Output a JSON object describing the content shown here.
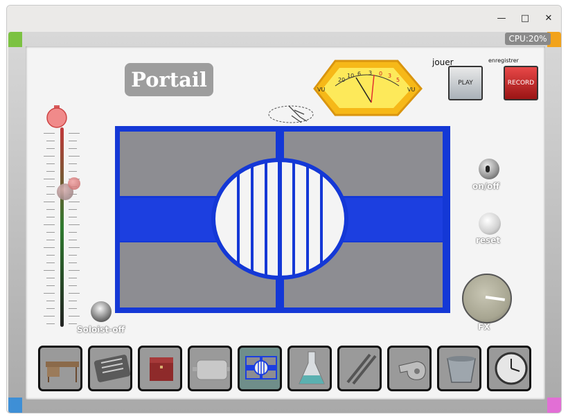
{
  "window": {
    "minimize_glyph": "—",
    "maximize_glyph": "□",
    "close_glyph": "✕"
  },
  "cpu_label": "CPU:20%",
  "title": "Portail",
  "controls": {
    "play_caption": "jouer",
    "play_button": "PLAY",
    "record_caption": "enregistrer",
    "record_button": "RECORD",
    "onoff_label": "on/off",
    "reset_label": "reset",
    "fx_label": "FX",
    "soloist_label": "Soloist-off"
  },
  "vu_meter": {
    "left_label": "VU",
    "right_label": "VU",
    "scale": [
      "20",
      "10",
      "6",
      "3",
      "0",
      "3",
      "5"
    ]
  },
  "colors": {
    "portal_blue": "#1438d6",
    "panel_gray": "#8d8d92",
    "selected_tray": "#6f8e8a",
    "cpu_bg": "#8a8a8a",
    "corner_green": "#7cc242",
    "corner_orange": "#f2a31b",
    "corner_blue": "#3e8fd6",
    "corner_pink": "#e26fd5"
  },
  "trays": [
    {
      "icon": "desk-icon",
      "selected": false
    },
    {
      "icon": "cutlery-tray-icon",
      "selected": false
    },
    {
      "icon": "red-box-icon",
      "selected": false
    },
    {
      "icon": "metal-tray-icon",
      "selected": false
    },
    {
      "icon": "portal-icon",
      "selected": true
    },
    {
      "icon": "flask-icon",
      "selected": false
    },
    {
      "icon": "metal-rods-icon",
      "selected": false
    },
    {
      "icon": "whistle-icon",
      "selected": false
    },
    {
      "icon": "glass-bowl-icon",
      "selected": false
    },
    {
      "icon": "clock-icon",
      "selected": false
    }
  ]
}
